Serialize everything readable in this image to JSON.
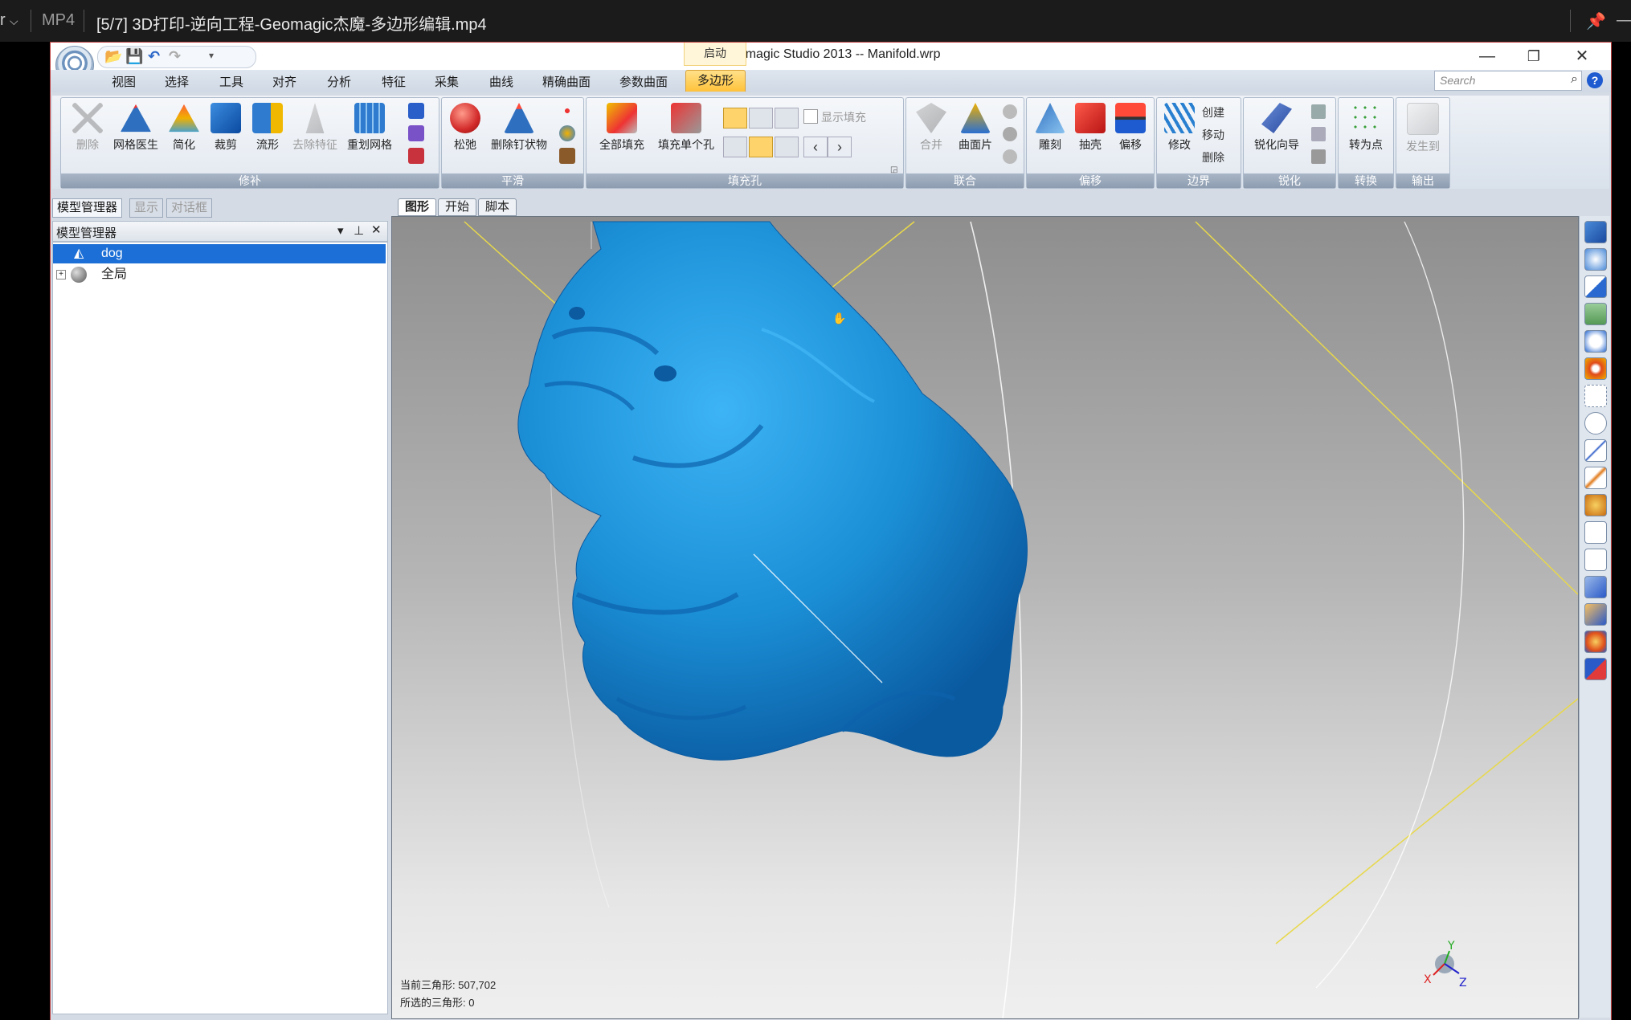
{
  "player": {
    "left_glyph": "r",
    "format": "MP4",
    "video_title": "[5/7] 3D打印-逆向工程-Geomagic杰魔-多边形编辑.mp4"
  },
  "window": {
    "title": "Geomagic Studio 2013 -- Manifold.wrp",
    "context_tab": "启动",
    "controls": {
      "minimize": "—",
      "restore": "❐",
      "close": "✕"
    }
  },
  "menu": {
    "tabs": [
      "视图",
      "选择",
      "工具",
      "对齐",
      "分析",
      "特征",
      "采集",
      "曲线",
      "精确曲面",
      "参数曲面",
      "多边形"
    ],
    "active_tab": "多边形",
    "search_placeholder": "Search",
    "help": "?"
  },
  "ribbon": {
    "groups": {
      "repair": {
        "label": "修补",
        "buttons": [
          "删除",
          "网格医生",
          "简化",
          "裁剪",
          "流形",
          "去除特征",
          "重划网格"
        ]
      },
      "smooth": {
        "label": "平滑",
        "buttons": [
          "松弛",
          "删除钉状物"
        ]
      },
      "fill": {
        "label": "填充孔",
        "buttons": [
          "全部填充",
          "填充单个孔"
        ],
        "checkbox_label": "显示填充"
      },
      "combine": {
        "label": "联合",
        "buttons": [
          "合并",
          "曲面片"
        ]
      },
      "offset": {
        "label": "偏移",
        "buttons": [
          "雕刻",
          "抽壳",
          "偏移"
        ]
      },
      "boundary": {
        "label": "边界",
        "buttons": [
          "修改"
        ],
        "small": [
          "创建",
          "移动",
          "删除"
        ]
      },
      "sharpen": {
        "label": "锐化",
        "buttons": [
          "锐化向导"
        ]
      },
      "convert": {
        "label": "转换",
        "buttons": [
          "转为点"
        ]
      },
      "output": {
        "label": "输出",
        "buttons": [
          "发生到"
        ]
      }
    }
  },
  "left_panel": {
    "tabs": [
      "模型管理器",
      "显示",
      "对话框"
    ],
    "header": "模型管理器",
    "tree": [
      {
        "label": "dog",
        "selected": true
      },
      {
        "label": "全局",
        "selected": false
      }
    ]
  },
  "view": {
    "tabs": [
      "图形",
      "开始",
      "脚本"
    ],
    "model_color": "#1b8fd6",
    "status": {
      "current_triangles_label": "当前三角形:",
      "current_triangles": "507,702",
      "selected_triangles_label": "所选的三角形:",
      "selected_triangles": "0"
    },
    "axes": {
      "x": "X",
      "y": "Y",
      "z": "Z"
    }
  }
}
